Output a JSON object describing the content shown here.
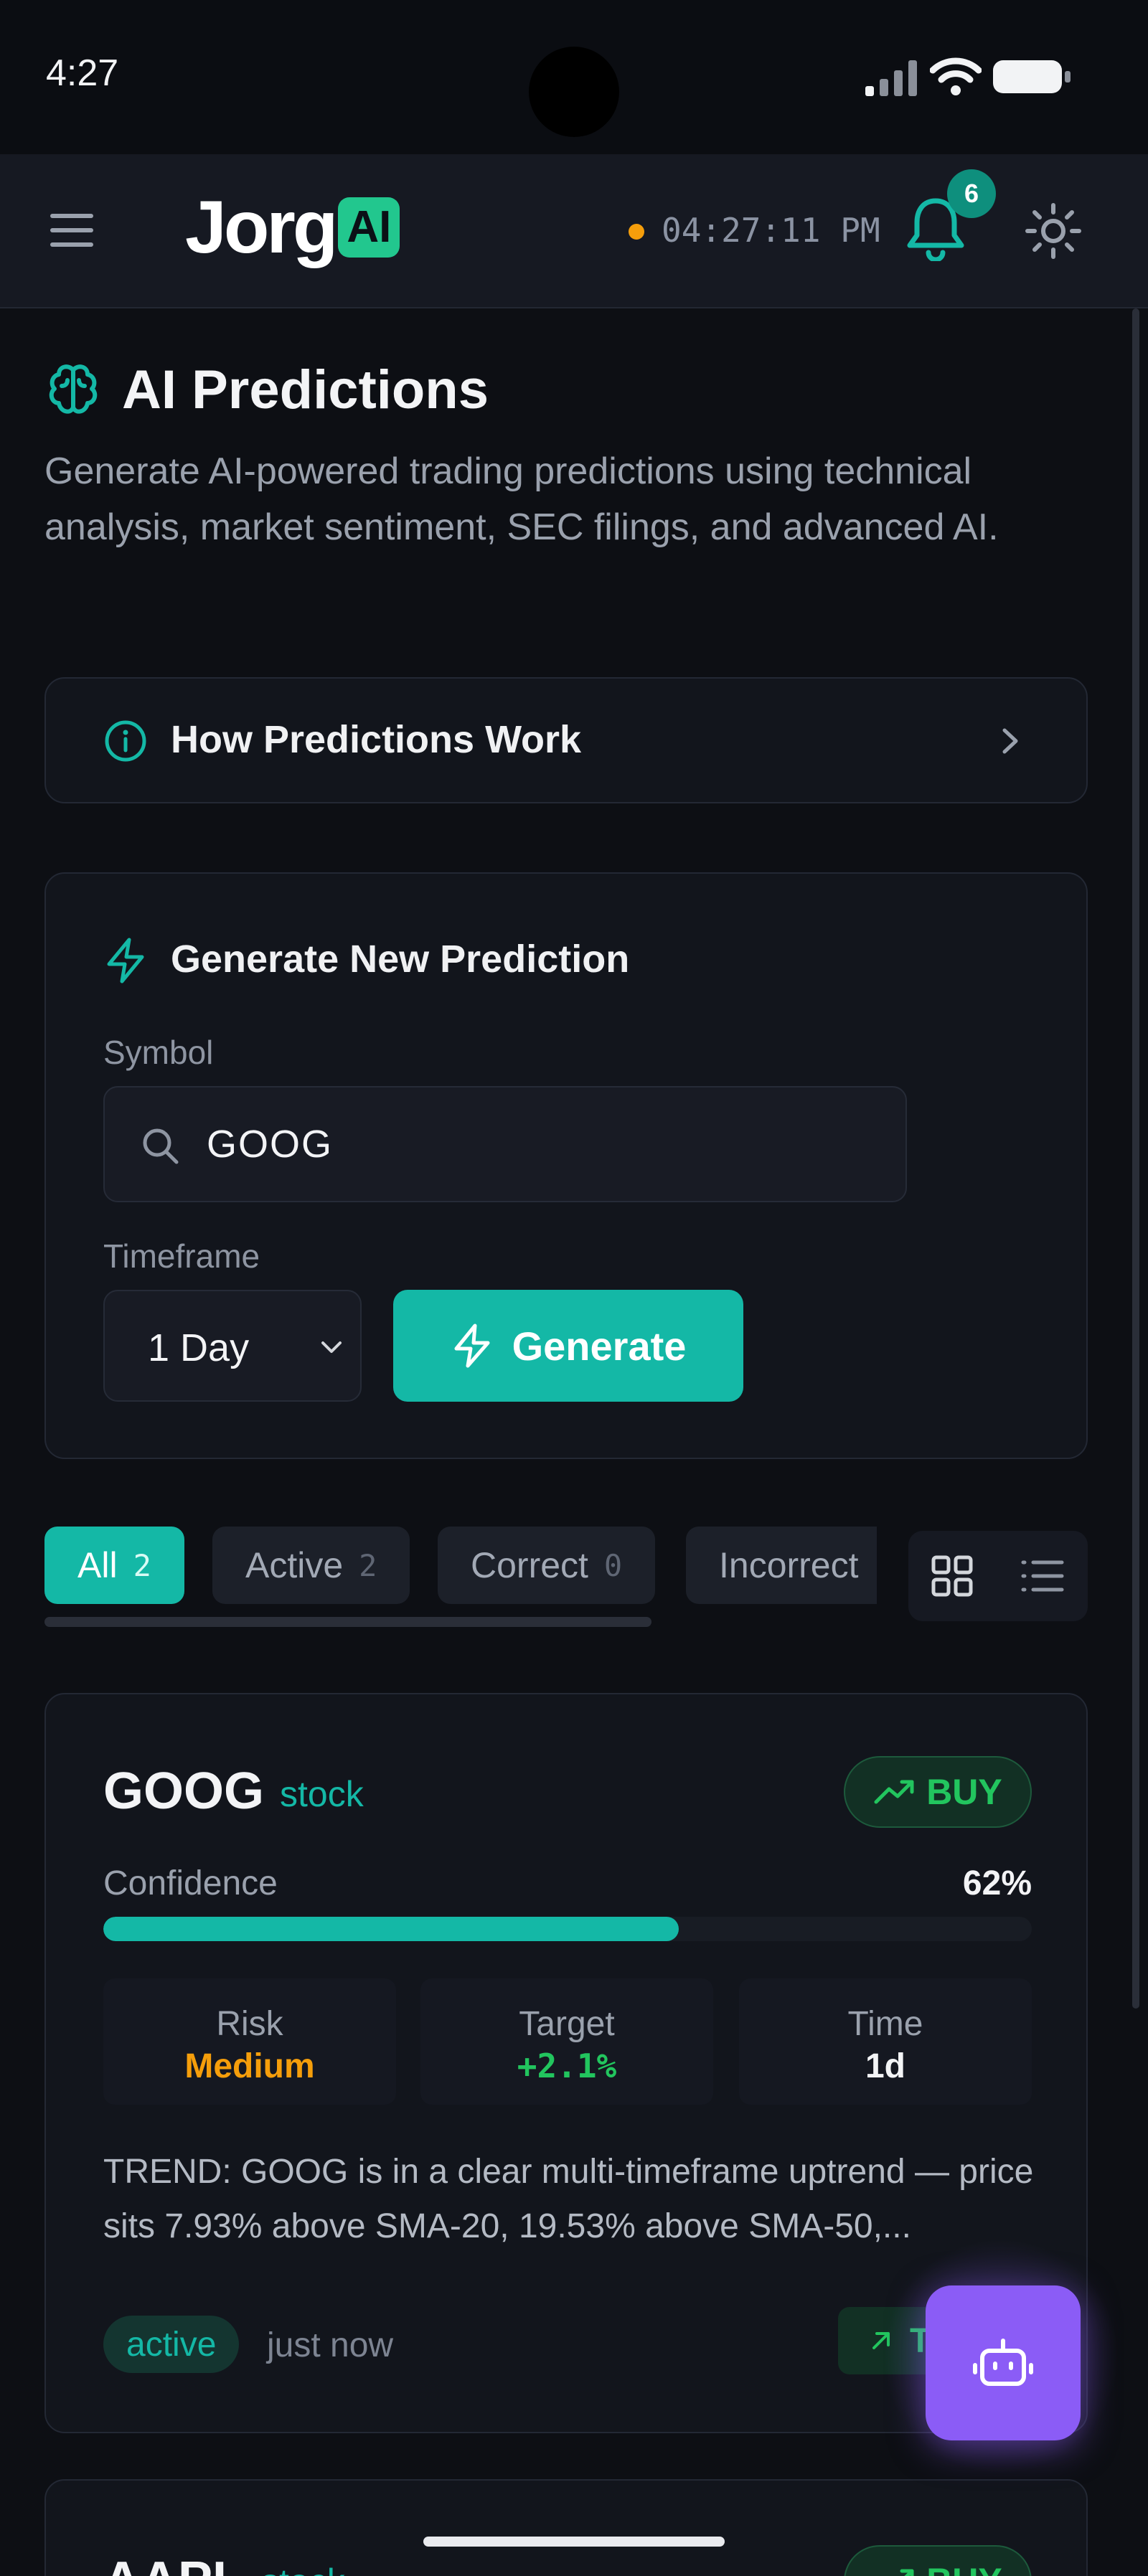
{
  "status_bar": {
    "time": "4:27"
  },
  "header": {
    "logo_text": "Jorg",
    "logo_badge": "AI",
    "clock": "04:27:11 PM",
    "clock_dot_color": "#f59e0b",
    "notification_count": "6",
    "icons": [
      "menu-icon",
      "bell-icon",
      "sun-icon"
    ]
  },
  "page": {
    "title": "AI Predictions",
    "description": "Generate AI-powered trading predictions using technical analysis, market sentiment, SEC filings, and advanced AI."
  },
  "how_it_works": {
    "label": "How Predictions Work"
  },
  "generator": {
    "title": "Generate New Prediction",
    "symbol_label": "Symbol",
    "symbol_value": "GOOG",
    "timeframe_label": "Timeframe",
    "timeframe_value": "1 Day",
    "generate_label": "Generate"
  },
  "filters": {
    "tabs": [
      {
        "label": "All",
        "count": "2"
      },
      {
        "label": "Active",
        "count": "2"
      },
      {
        "label": "Correct",
        "count": "0"
      },
      {
        "label": "Incorrect",
        "count": ""
      }
    ],
    "active_tab": "All"
  },
  "predictions": [
    {
      "symbol": "GOOG",
      "type": "stock",
      "signal": "BUY",
      "confidence_label": "Confidence",
      "confidence": "62%",
      "confidence_value": 0.62,
      "risk_label": "Risk",
      "risk": "Medium",
      "target_label": "Target",
      "target": "+2.1%",
      "time_label": "Time",
      "time": "1d",
      "summary": "TREND: GOOG is in a clear multi-timeframe uptrend — price sits 7.93% above SMA-20, 19.53% above SMA-50,...",
      "status": "active",
      "age": "just now",
      "track_label": "T"
    },
    {
      "symbol": "AAPL",
      "type": "stock",
      "signal": "BUY"
    }
  ],
  "colors": {
    "accent": "#14b8a6",
    "buy": "#22c55e",
    "medium_risk": "#f59e0b",
    "assistant": "#8b5cf6",
    "background": "#0d0f14"
  }
}
